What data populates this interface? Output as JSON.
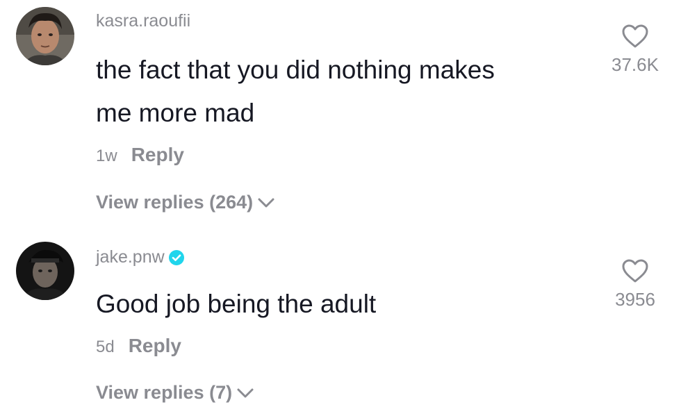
{
  "comments": [
    {
      "username": "kasra.raoufii",
      "verified": false,
      "text_line1": "the fact that you did nothing makes",
      "text_line2": "me more mad",
      "time": "1w",
      "reply_label": "Reply",
      "view_replies_label": "View replies (264)",
      "like_count": "37.6K"
    },
    {
      "username": "jake.pnw",
      "verified": true,
      "text_line1": "Good job being the adult",
      "time": "5d",
      "reply_label": "Reply",
      "view_replies_label": "View replies (7)",
      "like_count": "3956"
    }
  ],
  "colors": {
    "primary_text": "#161823",
    "secondary_text": "#8a8b91",
    "verified_badge": "#20d5ec"
  },
  "icons": {
    "like": "heart-outline-icon",
    "verified": "verified-check-icon",
    "expand": "chevron-down-icon"
  }
}
